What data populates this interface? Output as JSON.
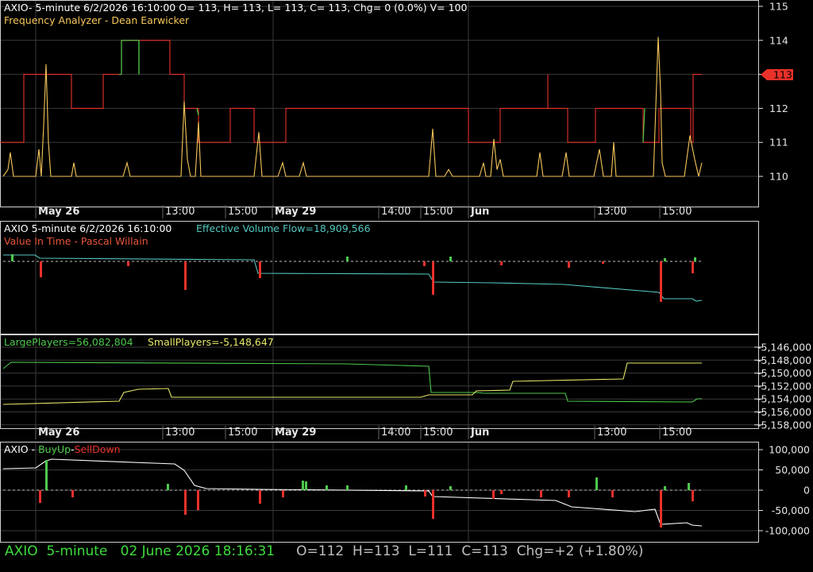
{
  "colors": {
    "background": "#000000",
    "grid": "#3a3a3a",
    "axis_text": "#e6e6e6",
    "orange": "#f7c75a",
    "red": "#e8312a",
    "green": "#4ec94e",
    "cyan": "#54c7c0",
    "yellow": "#e8e86a",
    "white": "#ffffff",
    "status_green": "#3ddc3d",
    "status_grey": "#bfbfbf"
  },
  "panel1": {
    "header": "AXIO- 5-minute 6/2/2026 16:10:00 O= 113, H= 113, L= 113, C= 113, Chg= 0 (0.0%) V= 100",
    "indicator": "Frequency Analyzer - Dean Earwicker",
    "price_badge": "113"
  },
  "panel2": {
    "header": "AXIO 5-minute  6/2/2026 16:10:00",
    "evf": "Effective Volume Flow=18,909,566",
    "indicator": "Value In Time - Pascal Willain"
  },
  "panel3": {
    "large": "LargePlayers=56,082,804",
    "small": "SmallPlayers=-5,148,647"
  },
  "panel4": {
    "prefix": "AXIO - ",
    "buyup": "BuyUp",
    "dash": "-",
    "selldown": "SellDown"
  },
  "time_axis": [
    "May 26",
    "13:00",
    "15:00",
    "May 29",
    "14:00",
    "15:00",
    "Jun",
    "13:00",
    "15:00"
  ],
  "status": {
    "symbol": "AXIO",
    "interval": "5-minute",
    "datetime": "02 June 2026 18:16:31",
    "open": "O=112",
    "high": "H=113",
    "low": "L=111",
    "close": "C=113",
    "change": "Chg=+2 (+1.80%)"
  },
  "chart_data": [
    {
      "type": "line",
      "title": "Frequency Analyzer - Dean Earwicker",
      "y_ticks": [
        "115",
        "114",
        "113",
        "112",
        "111",
        "110"
      ],
      "ylim": [
        109.75,
        115.25
      ],
      "x_ticks": [
        "May 26",
        "13:00",
        "15:00",
        "May 29",
        "14:00",
        "15:00",
        "Jun",
        "13:00",
        "15:00"
      ],
      "series": [
        {
          "name": "price step",
          "color": "red",
          "points": [
            [
              0,
              111
            ],
            [
              30,
              111
            ],
            [
              30,
              113
            ],
            [
              90,
              113
            ],
            [
              90,
              112
            ],
            [
              130,
              112
            ],
            [
              130,
              113
            ],
            [
              153,
              113
            ],
            [
              153,
              114
            ],
            [
              175,
              114
            ],
            [
              175,
              114
            ],
            [
              214,
              114
            ],
            [
              214,
              113
            ],
            [
              232,
              113
            ],
            [
              232,
              112
            ],
            [
              250,
              112
            ],
            [
              250,
              111
            ],
            [
              290,
              111
            ],
            [
              290,
              112
            ],
            [
              320,
              112
            ],
            [
              320,
              111
            ],
            [
              360,
              111
            ],
            [
              360,
              112
            ],
            [
              590,
              112
            ],
            [
              590,
              111
            ],
            [
              630,
              111
            ],
            [
              630,
              112
            ],
            [
              690,
              112
            ],
            [
              690,
              113
            ],
            [
              690,
              112
            ],
            [
              715,
              112
            ],
            [
              715,
              111
            ],
            [
              750,
              111
            ],
            [
              750,
              112
            ],
            [
              810,
              112
            ],
            [
              810,
              111
            ],
            [
              830,
              111
            ],
            [
              830,
              112
            ],
            [
              870,
              112
            ],
            [
              870,
              111
            ],
            [
              873,
              111
            ],
            [
              873,
              113
            ],
            [
              884,
              113
            ]
          ]
        },
        {
          "name": "frequency",
          "color": "orange",
          "points": [
            [
              4,
              110
            ],
            [
              10,
              110.2
            ],
            [
              13,
              110.7
            ],
            [
              17,
              110
            ],
            [
              45,
              110
            ],
            [
              49,
              110.8
            ],
            [
              52,
              110
            ],
            [
              55,
              111.5
            ],
            [
              58,
              113.3
            ],
            [
              61,
              111
            ],
            [
              64,
              110
            ],
            [
              90,
              110
            ],
            [
              93,
              110.4
            ],
            [
              96,
              110
            ],
            [
              155,
              110
            ],
            [
              160,
              110.4
            ],
            [
              164,
              110
            ],
            [
              228,
              110
            ],
            [
              232,
              112.2
            ],
            [
              236,
              110.5
            ],
            [
              240,
              110
            ],
            [
              246,
              110
            ],
            [
              250,
              111.6
            ],
            [
              253,
              110
            ],
            [
              320,
              110
            ],
            [
              326,
              111.3
            ],
            [
              330,
              110
            ],
            [
              350,
              110
            ],
            [
              356,
              110.4
            ],
            [
              360,
              110
            ],
            [
              377,
              110
            ],
            [
              382,
              110.4
            ],
            [
              386,
              110
            ],
            [
              540,
              110
            ],
            [
              545,
              111.4
            ],
            [
              549,
              110
            ],
            [
              560,
              110
            ],
            [
              565,
              110.2
            ],
            [
              570,
              110
            ],
            [
              604,
              110
            ],
            [
              609,
              110.4
            ],
            [
              612,
              110
            ],
            [
              618,
              110
            ],
            [
              622,
              111.1
            ],
            [
              626,
              110.2
            ],
            [
              630,
              110.5
            ],
            [
              634,
              110
            ],
            [
              676,
              110
            ],
            [
              680,
              110.7
            ],
            [
              684,
              110
            ],
            [
              708,
              110
            ],
            [
              713,
              110.7
            ],
            [
              717,
              110
            ],
            [
              748,
              110
            ],
            [
              755,
              110.8
            ],
            [
              760,
              110
            ],
            [
              770,
              110
            ],
            [
              773,
              111
            ],
            [
              776,
              110
            ],
            [
              823,
              110
            ],
            [
              829,
              114.1
            ],
            [
              832,
              112.5
            ],
            [
              834,
              110.4
            ],
            [
              838,
              110
            ],
            [
              862,
              110
            ],
            [
              869,
              111.2
            ],
            [
              875,
              110.5
            ],
            [
              880,
              110
            ],
            [
              884,
              110.4
            ]
          ]
        },
        {
          "name": "up ticks",
          "color": "green",
          "points": [
            [
              150,
              113
            ],
            [
              153,
              113
            ],
            [
              153,
              114
            ],
            [
              175,
              114
            ],
            [
              175,
              113
            ],
            [
              175,
              114
            ],
            [
              248,
              112
            ],
            [
              250,
              111.8
            ],
            [
              810,
              111
            ],
            [
              812,
              112
            ]
          ]
        }
      ]
    },
    {
      "type": "line",
      "title": "Value In Time - Pascal Willain",
      "y_ticks": [],
      "series": [
        {
          "name": "Effective Volume Flow",
          "color": "cyan",
          "points": [
            [
              4,
              321
            ],
            [
              44,
              321
            ],
            [
              50,
              325
            ],
            [
              320,
              327
            ],
            [
              325,
              344
            ],
            [
              540,
              345
            ],
            [
              546,
              355
            ],
            [
              620,
              356
            ],
            [
              710,
              358
            ],
            [
              830,
              368
            ],
            [
              836,
              376
            ],
            [
              872,
              376
            ],
            [
              877,
              379
            ],
            [
              884,
              378
            ]
          ]
        }
      ]
    },
    {
      "type": "line",
      "title": "LargePlayers / SmallPlayers",
      "y_ticks": [
        "5,146,000",
        "5,148,000",
        "5,150,000",
        "5,152,000",
        "5,154,000",
        "5,156,000",
        "5,158,000"
      ],
      "series": [
        {
          "name": "LargePlayers",
          "color": "green",
          "points": [
            [
              4,
              464
            ],
            [
              14,
              456
            ],
            [
              435,
              458
            ],
            [
              540,
              461
            ],
            [
              543,
              494
            ],
            [
              600,
              494
            ],
            [
              610,
              495
            ],
            [
              712,
              495
            ],
            [
              715,
              505
            ],
            [
              872,
              506
            ],
            [
              878,
              502
            ],
            [
              884,
              502
            ]
          ]
        },
        {
          "name": "SmallPlayers",
          "color": "yellow",
          "points": [
            [
              4,
              509
            ],
            [
              150,
              505
            ],
            [
              156,
              494
            ],
            [
              174,
              490
            ],
            [
              212,
              489
            ],
            [
              216,
              500
            ],
            [
              530,
              500
            ],
            [
              540,
              497
            ],
            [
              595,
              497
            ],
            [
              600,
              492
            ],
            [
              642,
              491
            ],
            [
              646,
              480
            ],
            [
              785,
              477
            ],
            [
              790,
              457
            ],
            [
              884,
              457
            ]
          ]
        }
      ]
    },
    {
      "type": "line",
      "title": "BuyUp-SellDown",
      "y_ticks": [
        "100,000",
        "50,000",
        "0",
        "-50,000",
        "-100,000"
      ],
      "series": [
        {
          "name": "BuyUp-SellDown",
          "color": "white",
          "points": [
            [
              4,
              590
            ],
            [
              45,
              589
            ],
            [
              58,
              580
            ],
            [
              65,
              578
            ],
            [
              220,
              584
            ],
            [
              232,
              592
            ],
            [
              245,
              611
            ],
            [
              260,
              615
            ],
            [
              330,
              616
            ],
            [
              540,
              618
            ],
            [
              545,
              625
            ],
            [
              700,
              630
            ],
            [
              720,
              638
            ],
            [
              800,
              644
            ],
            [
              825,
              641
            ],
            [
              832,
              660
            ],
            [
              865,
              658
            ],
            [
              872,
              661
            ],
            [
              884,
              662
            ]
          ]
        }
      ]
    }
  ]
}
